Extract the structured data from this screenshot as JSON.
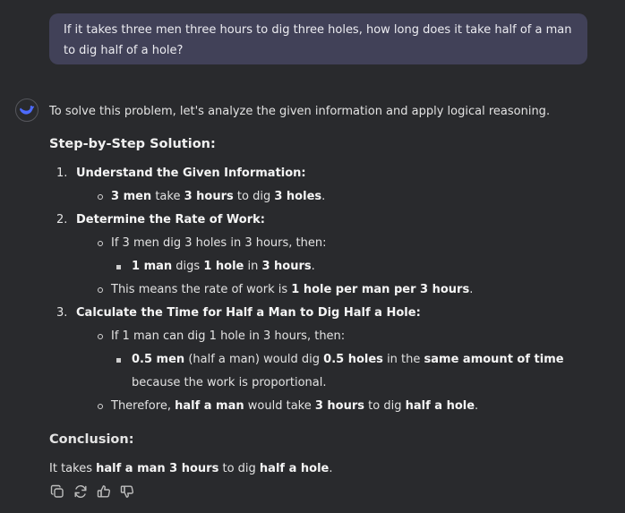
{
  "user_message": "If it takes three men three hours to dig three holes, how long does it take half of a man to dig half of a hole?",
  "answer": {
    "intro": "To solve this problem, let's analyze the given information and apply logical reasoning.",
    "heading": "Step-by-Step Solution:",
    "steps": [
      {
        "num": "1.",
        "title": "Understand the Given Information:",
        "bullets": [
          {
            "parts": [
              {
                "b": "3 men"
              },
              {
                "t": " take "
              },
              {
                "b": "3 hours"
              },
              {
                "t": " to dig "
              },
              {
                "b": "3 holes"
              },
              {
                "t": "."
              }
            ]
          }
        ]
      },
      {
        "num": "2.",
        "title": "Determine the Rate of Work:",
        "bullets": [
          {
            "parts": [
              {
                "t": "If 3 men dig 3 holes in 3 hours, then:"
              }
            ],
            "sub": [
              {
                "parts": [
                  {
                    "b": "1 man"
                  },
                  {
                    "t": " digs "
                  },
                  {
                    "b": "1 hole"
                  },
                  {
                    "t": " in "
                  },
                  {
                    "b": "3 hours"
                  },
                  {
                    "t": "."
                  }
                ]
              }
            ]
          },
          {
            "parts": [
              {
                "t": "This means the rate of work is "
              },
              {
                "b": "1 hole per man per 3 hours"
              },
              {
                "t": "."
              }
            ]
          }
        ]
      },
      {
        "num": "3.",
        "title": "Calculate the Time for Half a Man to Dig Half a Hole:",
        "bullets": [
          {
            "parts": [
              {
                "t": "If 1 man can dig 1 hole in 3 hours, then:"
              }
            ],
            "sub": [
              {
                "parts": [
                  {
                    "b": "0.5 men"
                  },
                  {
                    "t": " (half a man) would dig "
                  },
                  {
                    "b": "0.5 holes"
                  },
                  {
                    "t": " in the "
                  },
                  {
                    "b": "same amount of time"
                  },
                  {
                    "t": " because the work is proportional."
                  }
                ]
              }
            ]
          },
          {
            "parts": [
              {
                "t": "Therefore, "
              },
              {
                "b": "half a man"
              },
              {
                "t": " would take "
              },
              {
                "b": "3 hours"
              },
              {
                "t": " to dig "
              },
              {
                "b": "half a hole"
              },
              {
                "t": "."
              }
            ]
          }
        ]
      }
    ],
    "conclusion_heading": "Conclusion:",
    "conclusion_parts": [
      {
        "t": "It takes "
      },
      {
        "b": "half a man 3 hours"
      },
      {
        "t": " to dig "
      },
      {
        "b": "half a hole"
      },
      {
        "t": "."
      }
    ]
  },
  "actions": [
    {
      "name": "copy-icon"
    },
    {
      "name": "regenerate-icon"
    },
    {
      "name": "thumbs-up-icon"
    },
    {
      "name": "thumbs-down-icon"
    }
  ],
  "colors": {
    "background": "#292a2d",
    "user_bubble": "#414158",
    "text": "#e3e3e3",
    "avatar_accent": "#4d6bfe"
  }
}
